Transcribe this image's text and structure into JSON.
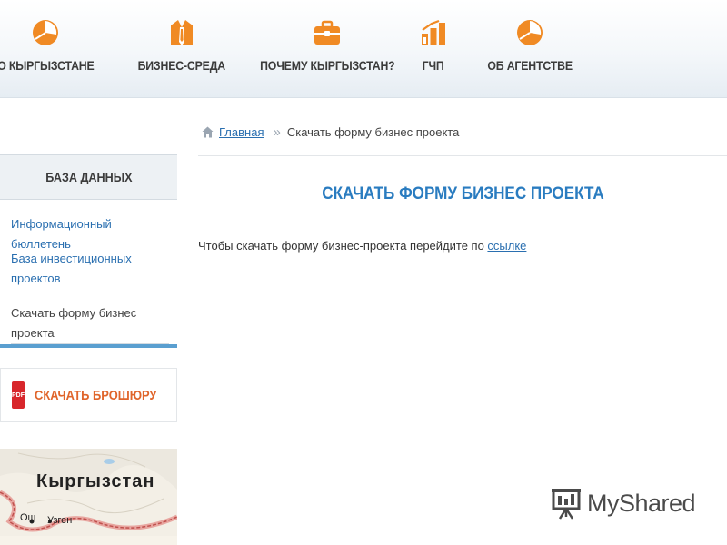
{
  "nav": {
    "items": [
      {
        "label": "О КЫРГЫЗСТАНЕ",
        "icon": "pie-chart-icon"
      },
      {
        "label": "БИЗНЕС-СРЕДА",
        "icon": "suit-tie-icon"
      },
      {
        "label": "ПОЧЕМУ КЫРГЫЗСТАН?",
        "icon": "briefcase-icon"
      },
      {
        "label": "ГЧП",
        "icon": "bar-chart-icon"
      },
      {
        "label": "ОБ АГЕНТСТВЕ",
        "icon": "pie-chart-icon"
      }
    ]
  },
  "breadcrumb": {
    "home": "Главная",
    "separator": "»",
    "current": "Скачать форму бизнес проекта"
  },
  "sidebar": {
    "title": "БАЗА ДАННЫХ",
    "items": [
      {
        "label": "Информационный бюллетень"
      },
      {
        "label": "База инвестиционных проектов"
      },
      {
        "label": "Скачать форму бизнес проекта"
      }
    ],
    "brochure": {
      "icon_text": "PDF",
      "label": "СКАЧАТЬ БРОШЮРУ"
    },
    "map": {
      "title": "Кыргызстан",
      "city_1": "Ош",
      "city_2": "Узген"
    }
  },
  "main": {
    "title": "СКАЧАТЬ ФОРМУ БИЗНЕС ПРОЕКТА",
    "text": "Чтобы скачать форму бизнес-проекта перейдите по ",
    "link": "ссылке"
  },
  "watermark": {
    "text": "MyShared"
  },
  "colors": {
    "accent_orange": "#f08a24",
    "link_blue": "#2a6fb0",
    "title_blue": "#2a7cc0",
    "sidebar_border_blue": "#5a9fd0",
    "pdf_red": "#d8262b"
  }
}
